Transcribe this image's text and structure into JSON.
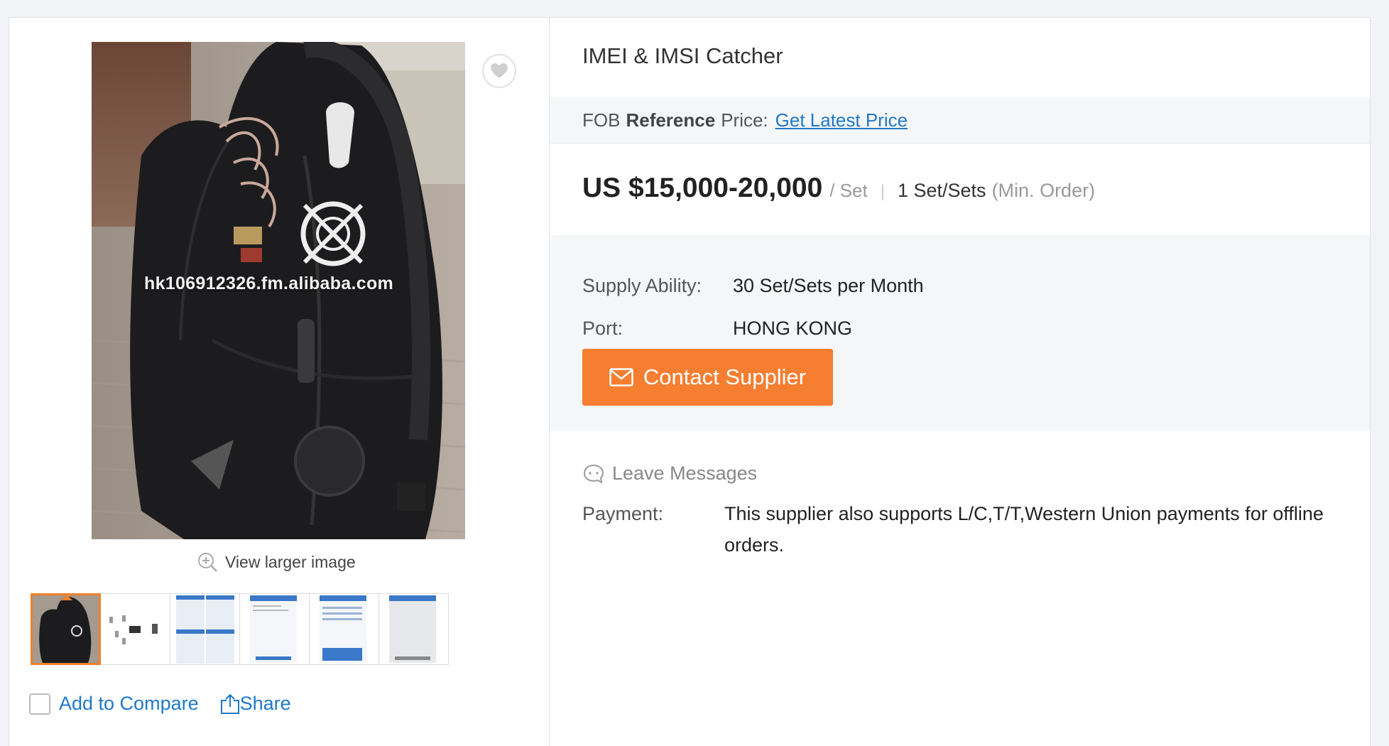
{
  "gallery": {
    "watermark": "hk106912326.fm.alibaba.com",
    "view_larger_label": "View larger image",
    "thumbnails": [
      "backpack-photo",
      "device-diagram",
      "screenshot-1",
      "screenshot-2",
      "screenshot-3",
      "screenshot-4"
    ],
    "active_thumbnail": 0
  },
  "actions": {
    "compare_label": "Add to Compare",
    "share_label": "Share"
  },
  "product": {
    "title": "IMEI & IMSI Catcher",
    "fob_prefix": "FOB",
    "fob_bold": "Reference",
    "fob_suffix": "Price:",
    "fob_link": "Get Latest Price",
    "price": "US $15,000-20,000",
    "price_unit": "/ Set",
    "min_qty": "1 Set/Sets",
    "min_label": "(Min. Order)"
  },
  "details": {
    "supply_label": "Supply Ability:",
    "supply_value": "30 Set/Sets per Month",
    "port_label": "Port:",
    "port_value": "HONG KONG"
  },
  "contact": {
    "button_label": "Contact Supplier",
    "leave_messages": "Leave Messages"
  },
  "payment": {
    "label": "Payment:",
    "value": "This supplier also supports L/C,T/T,Western Union payments for offline orders."
  },
  "colors": {
    "accent": "#f57e31",
    "link": "#1f78c8"
  }
}
